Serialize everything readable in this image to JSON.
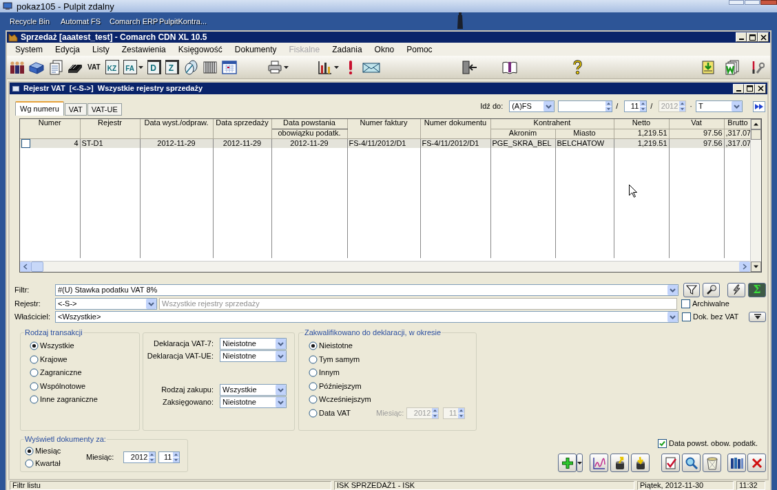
{
  "remote_session": {
    "title": "pokaz105 - Pulpit zdalny"
  },
  "desktop_icons": [
    "Recycle Bin",
    "Automat FS",
    "Comarch ERP",
    "PulpitKontra..."
  ],
  "window": {
    "title": "Sprzedaż [aaatest_test] - Comarch CDN XL 10.5"
  },
  "menu": [
    {
      "label": "System",
      "disabled": false
    },
    {
      "label": "Edycja",
      "disabled": false
    },
    {
      "label": "Listy",
      "disabled": false
    },
    {
      "label": "Zestawienia",
      "disabled": false
    },
    {
      "label": "Księgowość",
      "disabled": false
    },
    {
      "label": "Dokumenty",
      "disabled": false
    },
    {
      "label": "Fiskalne",
      "disabled": true
    },
    {
      "label": "Zadania",
      "disabled": false
    },
    {
      "label": "Okno",
      "disabled": false
    },
    {
      "label": "Pomoc",
      "disabled": false
    }
  ],
  "toolbar": [
    [
      {
        "kind": "people"
      },
      {
        "kind": "cubes"
      },
      {
        "kind": "documents"
      },
      {
        "kind": "books"
      },
      {
        "kind": "text",
        "label": "VAT"
      },
      {
        "kind": "tile",
        "label": "KZ"
      },
      {
        "kind": "tile",
        "label": "FA",
        "menu": true
      },
      {
        "kind": "stack",
        "label": "D"
      },
      {
        "kind": "stack",
        "label": "Z"
      },
      {
        "kind": "disks"
      },
      {
        "kind": "bars"
      },
      {
        "kind": "calendar"
      }
    ],
    [
      {
        "kind": "printer",
        "menu": true
      }
    ],
    [
      {
        "kind": "chart",
        "menu": true
      },
      {
        "kind": "alert"
      },
      {
        "kind": "envelope"
      }
    ],
    [
      {
        "kind": "exit"
      },
      {
        "kind": "book"
      }
    ],
    [
      {
        "kind": "help"
      }
    ],
    [
      {
        "kind": "import"
      },
      {
        "kind": "documents_w"
      },
      {
        "kind": "tools"
      }
    ]
  ],
  "register_window": {
    "title": "Rejestr VAT  [<-S->]  Wszystkie rejestry sprzedaży"
  },
  "tabs": [
    {
      "label": "Wg numeru",
      "selected": true
    },
    {
      "label": "VAT",
      "selected": false
    },
    {
      "label": "VAT-UE",
      "selected": false
    }
  ],
  "go_to": {
    "label": "Idź do:",
    "document_type": "(A)FS",
    "month": {
      "value": "11",
      "disabled": false
    },
    "year": {
      "value": "2012",
      "disabled": true
    },
    "series": "T",
    "separators": [
      "/",
      "/",
      "·"
    ]
  },
  "table": {
    "columns": [
      {
        "label": "Numer"
      },
      {
        "label": "Rejestr"
      },
      {
        "label": "Data wyst./odpraw."
      },
      {
        "label": "Data sprzedaży"
      },
      {
        "label": "Data powstania",
        "sublabel": "obowiązku podatk."
      },
      {
        "label": "Numer faktury"
      },
      {
        "label": "Numer dokumentu"
      },
      {
        "label": "Kontrahent",
        "colspan": 2,
        "children": [
          "Akronim",
          "Miasto"
        ]
      },
      {
        "label": "Netto",
        "total": "1,219.51"
      },
      {
        "label": "Vat",
        "total": "97.56"
      },
      {
        "label": "Brutto",
        "total": ",317.07"
      }
    ],
    "rows": [
      {
        "checked": false,
        "selected": true,
        "cells": [
          "4",
          "ST-D1",
          "2012-11-29",
          "2012-11-29",
          "2012-11-29",
          "FS-4/11/2012/D1",
          "FS-4/11/2012/D1",
          "PGE_SKRA_BEL",
          "BELCHATOW",
          "1,219.51",
          "97.56",
          ",317.07"
        ]
      }
    ]
  },
  "filters": {
    "filter": {
      "label": "Filtr:",
      "value": "#(U) Stawka podatku VAT 8%"
    },
    "sum_button": "Σ",
    "register": {
      "label": "Rejestr:",
      "value": "<-S->",
      "description": {
        "value": "Wszystkie rejestry sprzedaży",
        "disabled": true
      }
    },
    "owner": {
      "label": "Właściciel:",
      "value": "<Wszystkie>"
    },
    "archived": {
      "label": "Archiwalne",
      "checked": false
    },
    "no_vat": {
      "label": "Dok. bez VAT",
      "checked": false
    }
  },
  "transaction_type": {
    "title": "Rodzaj transakcji",
    "options": [
      {
        "label": "Wszystkie",
        "selected": true
      },
      {
        "label": "Krajowe",
        "selected": false
      },
      {
        "label": "Zagraniczne",
        "selected": false
      },
      {
        "label": "Wspólnotowe",
        "selected": false
      },
      {
        "label": "Inne zagraniczne",
        "selected": false
      }
    ]
  },
  "declarations": [
    [
      {
        "label": "Deklaracja VAT-7:",
        "value": "Nieistotne"
      },
      {
        "label": "Deklaracja VAT-UE:",
        "value": "Nieistotne"
      }
    ],
    [
      {
        "label": "Rodzaj zakupu:",
        "value": "Wszystkie"
      },
      {
        "label": "Zaksięgowano:",
        "value": "Nieistotne"
      }
    ]
  ],
  "qualified": {
    "title": "Zakwalifikowano do deklaracji, w okresie",
    "options": [
      {
        "label": "Nieistotne",
        "selected": true
      },
      {
        "label": "Tym samym",
        "selected": false
      },
      {
        "label": "Innym",
        "selected": false
      },
      {
        "label": "Późniejszym",
        "selected": false
      },
      {
        "label": "Wcześniejszym",
        "selected": false
      },
      {
        "label": "Data VAT",
        "selected": false
      }
    ],
    "month": {
      "label": "Miesiąc:",
      "year": "2012",
      "month": "11",
      "disabled": true
    }
  },
  "display_period": {
    "title": "Wyświetl dokumenty za:",
    "options": [
      {
        "label": "Miesiąc",
        "selected": true
      },
      {
        "label": "Kwartał",
        "selected": false
      }
    ],
    "month": {
      "label": "Miesiąc:",
      "year": "2012",
      "month": "11",
      "disabled": false
    }
  },
  "tax_date": {
    "label": "Data powst. obow. podatk.",
    "checked": true
  },
  "buttons": [
    {
      "kind": "add",
      "menu": true
    },
    {
      "kind": "chart"
    },
    {
      "kind": "upload"
    },
    {
      "kind": "download"
    },
    {
      "kind": "approve"
    },
    {
      "kind": "search"
    },
    {
      "kind": "delete"
    },
    {
      "kind": "binders"
    },
    {
      "kind": "close"
    }
  ],
  "status_bar": [
    "Filtr listu",
    "ISK SPRZEDAŻ1 - ISK",
    "Piątek, 2012-11-30",
    "11:32"
  ]
}
